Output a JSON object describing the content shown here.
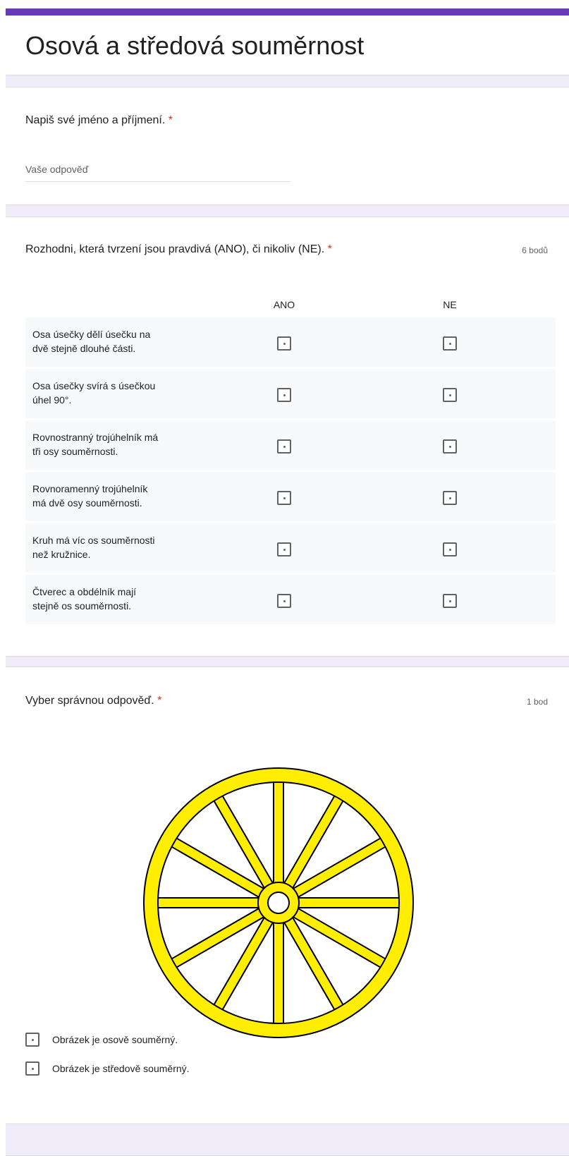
{
  "form": {
    "title": "Osová a středová souměrnost"
  },
  "q1": {
    "title": "Napiš své jméno a příjmení.",
    "required_mark": "*",
    "placeholder": "Vaše odpověď"
  },
  "q2": {
    "title": "Rozhodni, která tvrzení jsou pravdivá (ANO), či nikoliv (NE).",
    "required_mark": "*",
    "points": "6 bodů",
    "columns": [
      "ANO",
      "NE"
    ],
    "rows": [
      {
        "line1": "Osa úsečky dělí úsečku na",
        "line2": "dvě stejně dlouhé části."
      },
      {
        "line1": "Osa úsečky svírá s úsečkou",
        "line2": "úhel 90°."
      },
      {
        "line1": "Rovnostranný trojúhelník má",
        "line2": "tři osy souměrnosti."
      },
      {
        "line1": "Rovnoramenný trojúhelník",
        "line2": "má dvě osy souměrnosti."
      },
      {
        "line1": "Kruh má víc os souměrnosti",
        "line2": "než kružnice."
      },
      {
        "line1": "Čtverec a obdélník mají",
        "line2": "stejně os souměrnosti."
      }
    ]
  },
  "q3": {
    "title": "Vyber správnou odpověď.",
    "required_mark": "*",
    "points": "1 bod",
    "image_colors": {
      "fill": "#ffee00",
      "stroke": "#000000"
    },
    "options": [
      "Obrázek je osově souměrný.",
      "Obrázek je středově souměrný."
    ]
  }
}
